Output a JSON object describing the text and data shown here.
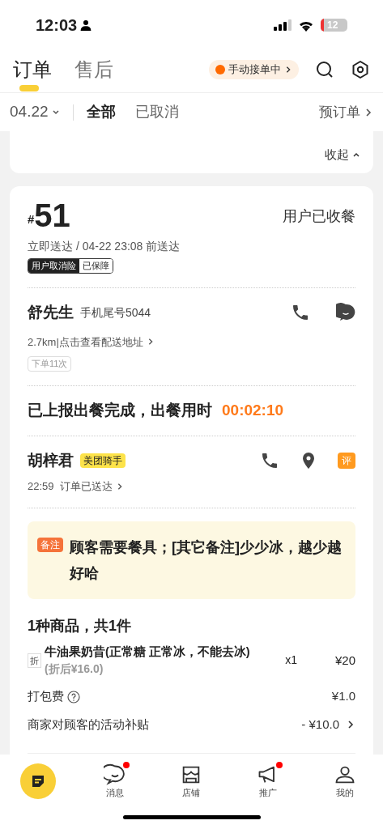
{
  "status_bar": {
    "time": "12:03",
    "battery": "12"
  },
  "header": {
    "tabs": [
      {
        "label": "订单",
        "selected": true
      },
      {
        "label": "售后",
        "selected": false
      }
    ],
    "mode_badge": "手动接单中"
  },
  "filter": {
    "date": "04.22",
    "options": [
      {
        "label": "全部",
        "selected": true
      },
      {
        "label": "已取消",
        "selected": false
      }
    ],
    "preorder": "预订单"
  },
  "previous_card": {
    "collapse": "收起"
  },
  "order": {
    "hash": "#",
    "number": "51",
    "status": "用户已收餐",
    "delivery": "立即送达 / 04-22 23:08 前送达",
    "insurance": [
      "用户取消险",
      "已保障"
    ],
    "customer": {
      "name": "舒先生",
      "phone": "手机尾号5044",
      "address": "2.7km|点击查看配送地址",
      "order_count": "下单11次"
    },
    "meal_report": "已上报出餐完成，出餐用时",
    "meal_time": "00:02:10",
    "rider": {
      "name": "胡梓君",
      "tag": "美团骑手",
      "time": "22:59",
      "status": "订单已送达",
      "review": "评"
    },
    "note_label": "备注",
    "note": "顾客需要餐具；[其它备注]少少冰，越少越好哈",
    "items_summary": "1种商品，共1件",
    "items": [
      {
        "tag": "折",
        "name": "牛油果奶昔(正常糖 正常冰，不能去冰)",
        "discounted": "(折后¥16.0)",
        "qty": "x1",
        "price": "¥20"
      }
    ],
    "fees": [
      {
        "label": "打包费",
        "help": true,
        "value": "¥1.0",
        "link": false
      },
      {
        "label": "商家对顾客的活动补贴",
        "help": false,
        "value": "- ¥10.0",
        "link": true
      }
    ]
  },
  "bottom_nav": [
    {
      "kind": "orders",
      "dot": false
    },
    {
      "kind": "messages",
      "label": "消息",
      "dot": true
    },
    {
      "kind": "store",
      "label": "店铺",
      "dot": false
    },
    {
      "kind": "promote",
      "label": "推广",
      "dot": true
    },
    {
      "kind": "profile",
      "label": "我的",
      "dot": false
    }
  ]
}
